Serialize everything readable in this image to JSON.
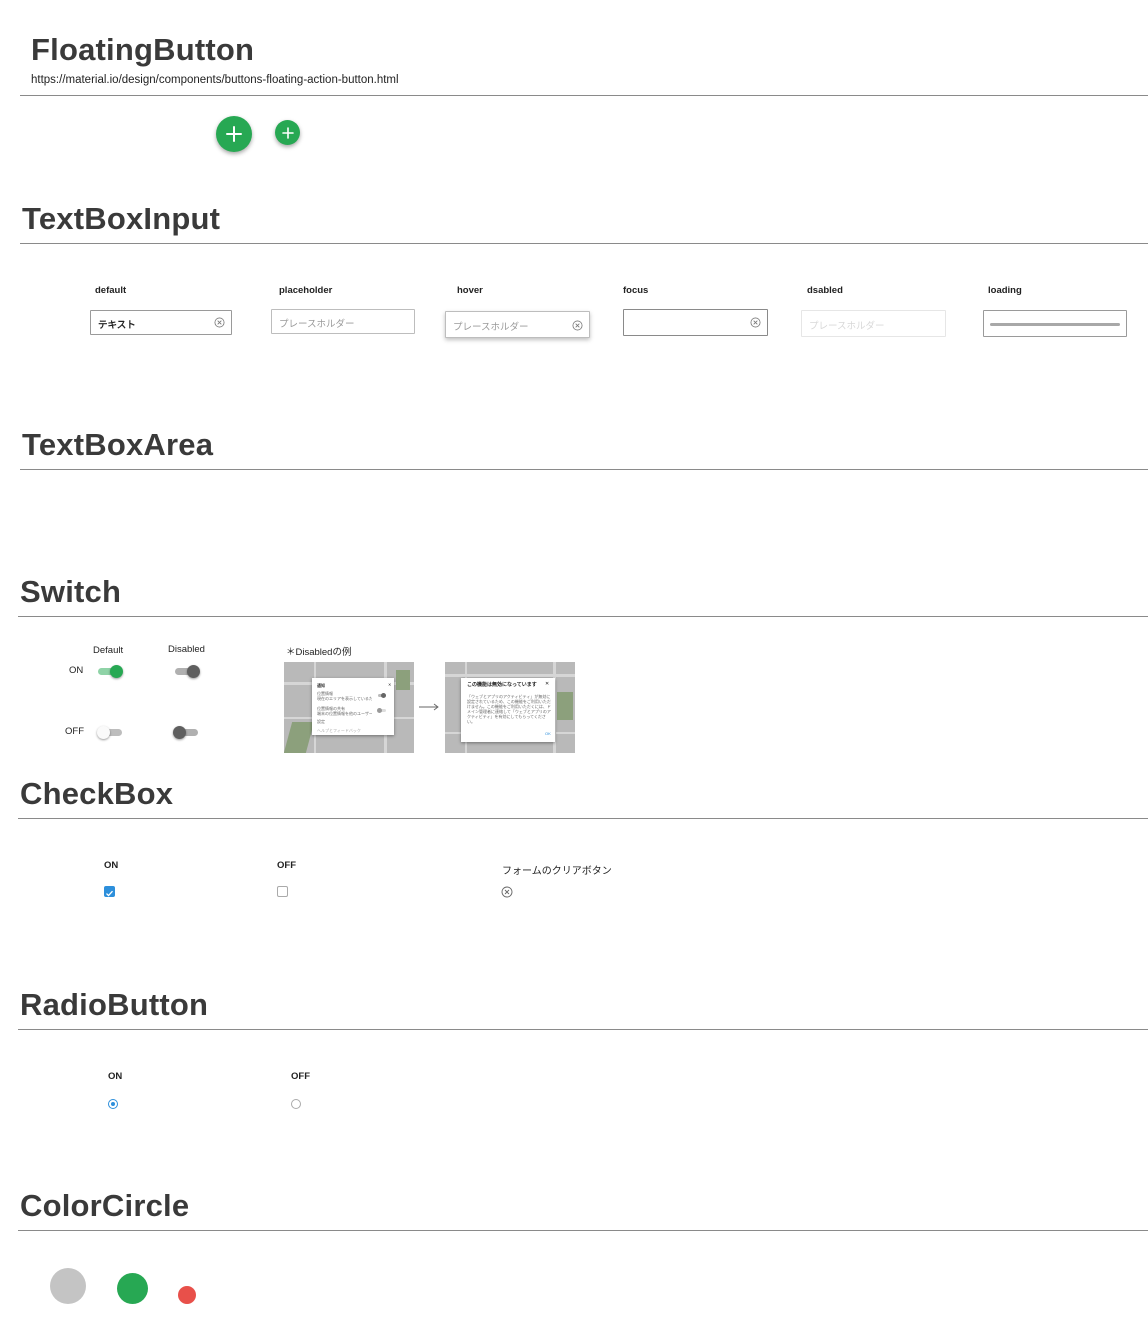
{
  "sections": {
    "floating_button": {
      "title": "FloatingButton",
      "url": "https://material.io/design/components/buttons-floating-action-button.html"
    },
    "textbox_input": {
      "title": "TextBoxInput",
      "states": {
        "default": {
          "label": "default",
          "value": "テキスト"
        },
        "placeholder": {
          "label": "placeholder",
          "placeholder": "プレースホルダー"
        },
        "hover": {
          "label": "hover",
          "placeholder": "プレースホルダー"
        },
        "focus": {
          "label": "focus"
        },
        "disabled": {
          "label": "dsabled",
          "placeholder": "プレースホルダー"
        },
        "loading": {
          "label": "loading"
        }
      }
    },
    "textbox_area": {
      "title": "TextBoxArea"
    },
    "switch": {
      "title": "Switch",
      "col_default": "Default",
      "col_disabled": "Disabled",
      "row_on": "ON",
      "row_off": "OFF",
      "example_label": "＊Disabledの例",
      "example_before": {
        "dialog_title": "通知",
        "line1": "位置情報",
        "line2": "現在のエリアを表示しているため、",
        "line3": "位置情報の共有",
        "line4": "端末の位置情報を他のユーザーと共有",
        "line5": "設定",
        "footer": "ヘルプとフィードバック"
      },
      "example_after": {
        "dialog_title": "この機能は無効になっています",
        "body": "「ウェブとアプリのアクティビティ」が無効に設定されているため、この機能をご利用いただけません。この機能をご利用いただくには、ドメイン管理者に連絡して「ウェブとアプリのアクティビティ」を有効にしてもらってください。",
        "ok": "OK"
      }
    },
    "checkbox": {
      "title": "CheckBox",
      "on": "ON",
      "off": "OFF",
      "clear_label": "フォームのクリアボタン"
    },
    "radio": {
      "title": "RadioButton",
      "on": "ON",
      "off": "OFF"
    },
    "color_circle": {
      "title": "ColorCircle"
    }
  },
  "colors": {
    "green": "#27a853",
    "blue": "#2d8fdb",
    "gray": "#c4c4c4",
    "red": "#e8504a",
    "switch_off_knob": "#5f5f5f"
  },
  "icons": {
    "fab": "plus-icon",
    "clear": "clear-circle-x-icon",
    "check": "check-icon",
    "arrow": "arrow-right-icon"
  }
}
